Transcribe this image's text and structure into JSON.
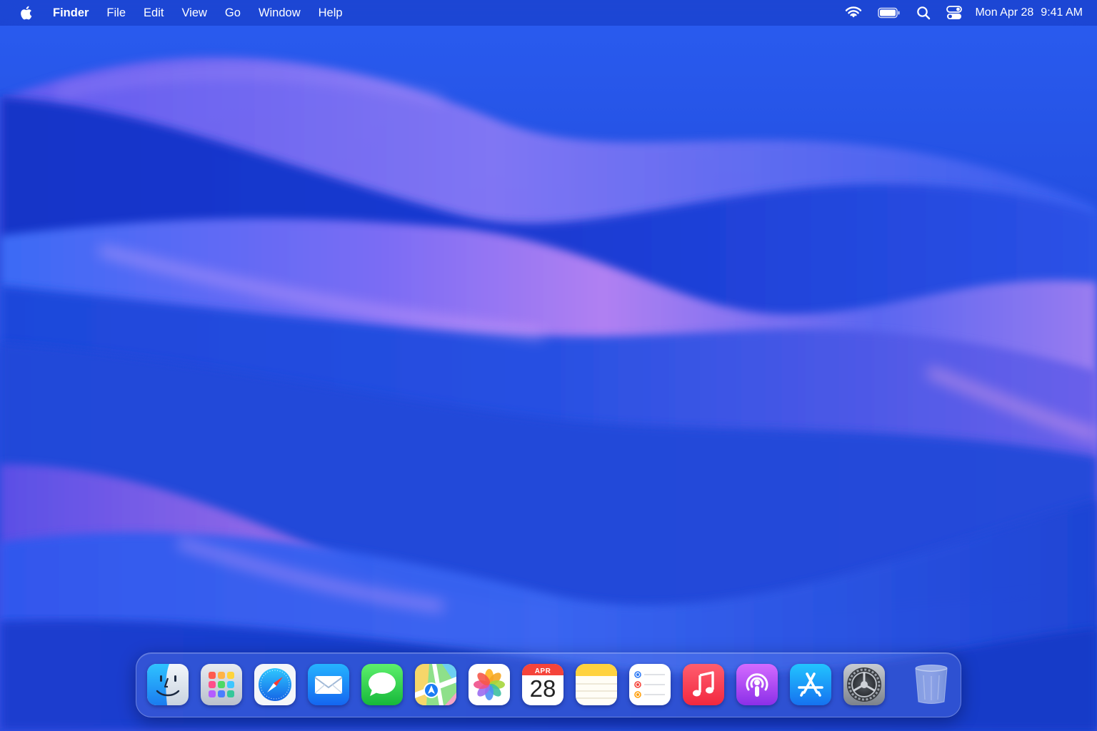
{
  "menubar": {
    "app_name": "Finder",
    "menus": [
      "File",
      "Edit",
      "View",
      "Go",
      "Window",
      "Help"
    ],
    "status_icons": [
      "wifi-icon",
      "battery-icon",
      "spotlight-search-icon",
      "control-center-icon"
    ],
    "clock": {
      "date": "Mon Apr 28",
      "time": "9:41 AM"
    }
  },
  "dock": {
    "apps": [
      {
        "name": "Finder",
        "icon": "finder-icon"
      },
      {
        "name": "Launchpad",
        "icon": "launchpad-icon"
      },
      {
        "name": "Safari",
        "icon": "safari-icon"
      },
      {
        "name": "Mail",
        "icon": "mail-icon"
      },
      {
        "name": "Messages",
        "icon": "messages-icon"
      },
      {
        "name": "Maps",
        "icon": "maps-icon"
      },
      {
        "name": "Photos",
        "icon": "photos-icon"
      },
      {
        "name": "Calendar",
        "icon": "calendar-icon",
        "month": "APR",
        "day": "28"
      },
      {
        "name": "Notes",
        "icon": "notes-icon"
      },
      {
        "name": "Reminders",
        "icon": "reminders-icon"
      },
      {
        "name": "Music",
        "icon": "music-icon"
      },
      {
        "name": "Podcasts",
        "icon": "podcasts-icon"
      },
      {
        "name": "App Store",
        "icon": "app-store-icon"
      },
      {
        "name": "System Settings",
        "icon": "system-settings-icon"
      },
      {
        "name": "Trash",
        "icon": "trash-icon"
      }
    ]
  },
  "colors": {
    "wallpaper_base": "#1e45d8",
    "wallpaper_deep": "#0f2aa8",
    "wallpaper_highlight": "#c48cf5",
    "menubar_text": "#ffffff"
  }
}
